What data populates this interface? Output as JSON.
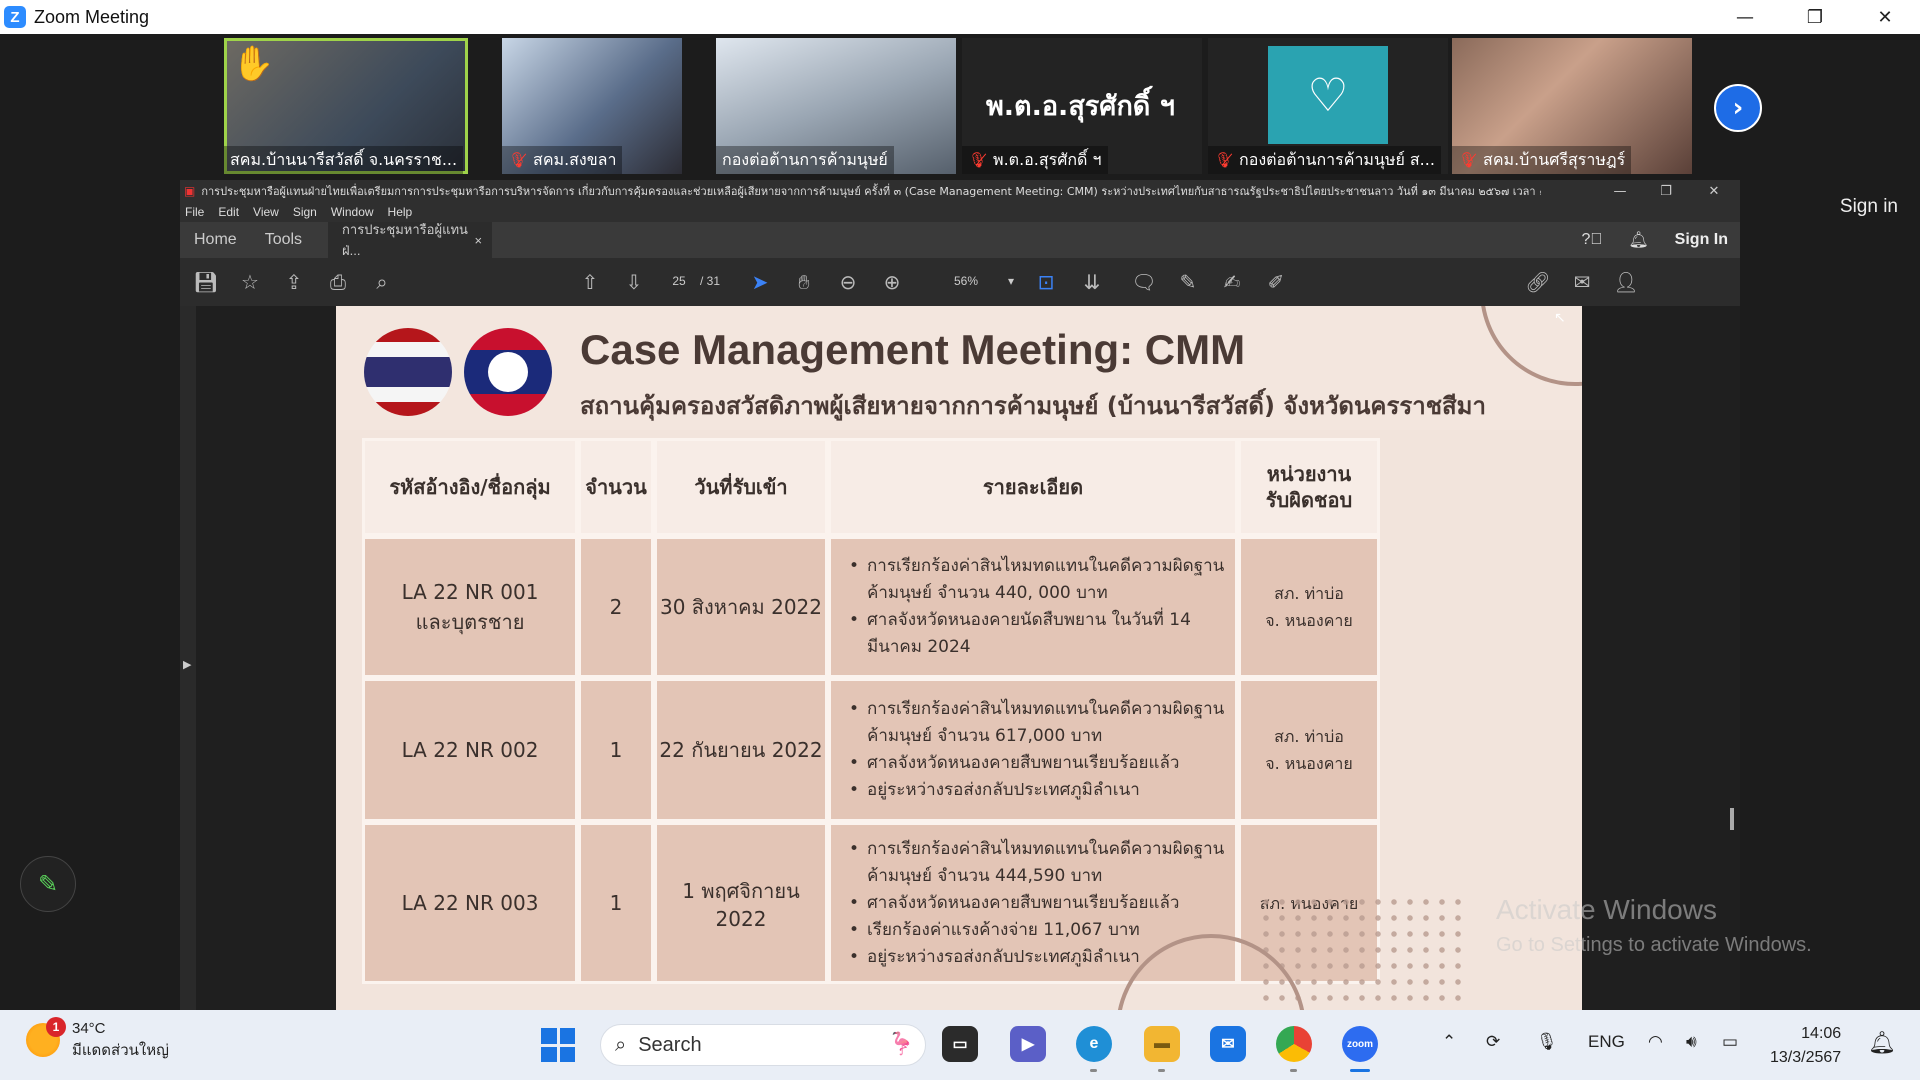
{
  "window": {
    "title": "Zoom Meeting",
    "minimize": "—",
    "maximize": "❐",
    "close": "✕"
  },
  "participants": [
    {
      "name": "สคม.บ้านนารีสวัสดิ์ จ.นครราช...",
      "muted": false,
      "raised_hand": true,
      "active": true
    },
    {
      "name": "สคม.สงขลา",
      "muted": true
    },
    {
      "name": "กองต่อต้านการค้ามนุษย์",
      "muted": false
    },
    {
      "name": "พ.ต.อ.สุรศักดิ์ ฯ",
      "muted": true,
      "display_text": "พ.ต.อ.สุรศักดิ์ ฯ"
    },
    {
      "name": "กองต่อต้านการค้ามนุษย์ ส...",
      "muted": true
    },
    {
      "name": "สคม.บ้านศรีสุราษฎร์",
      "muted": true
    }
  ],
  "zoom_side": {
    "sign_in": "Sign in"
  },
  "acrobat": {
    "doc_window_title": "การประชุมหารือผู้แทนฝ่ายไทยเพื่อเตรียมการการประชุมหารือการบริหารจัดการ เกี่ยวกับการคุ้มครองและช่วยเหลือผู้เสียหายจากการค้ามนุษย์ ครั้งที่ ๓ (Case Management Meeting: CMM) ระหว่างประเทศไทยกับสาธารณรัฐประชาธิปไตยประชาชนลาว วันที่ ๑๓ มีนาคม ๒๕๖๗ เวลา ๑๓.๓๐ -",
    "menu": [
      "File",
      "Edit",
      "View",
      "Sign",
      "Window",
      "Help"
    ],
    "tabs": {
      "home": "Home",
      "tools": "Tools",
      "doc": "การประชุมหารือผู้แทนฝ่...",
      "close": "×"
    },
    "sign_in": "Sign In",
    "page_current": "25",
    "page_total": "/ 31",
    "zoom": "56%"
  },
  "slide": {
    "title": "Case Management Meeting: CMM",
    "subtitle": "สถานคุ้มครองสวัสดิภาพผู้เสียหายจากการค้ามนุษย์ (บ้านนารีสวัสดิ์) จังหวัดนครราชสีมา",
    "headers": [
      "รหัสอ้างอิง/ชื่อกลุ่ม",
      "จำนวน",
      "วันที่รับเข้า",
      "รายละเอียด",
      "หน่วยงาน\nรับผิดชอบ"
    ],
    "rows": [
      {
        "ref": "LA 22 NR 001\nและบุตรชาย",
        "count": "2",
        "date": "30 สิงหาคม 2022",
        "details": [
          "การเรียกร้องค่าสินไหมทดแทนในคดีความผิดฐานค้ามนุษย์ จำนวน 440, 000 บาท",
          "ศาลจังหวัดหนองคายนัดสืบพยาน ในวันที่ 14 มีนาคม 2024"
        ],
        "unit": "สภ. ท่าบ่อ\nจ. หนองคาย"
      },
      {
        "ref": "LA 22 NR 002",
        "count": "1",
        "date": "22 กันยายน 2022",
        "details": [
          "การเรียกร้องค่าสินไหมทดแทนในคดีความผิดฐานค้ามนุษย์ จำนวน 617,000 บาท",
          "ศาลจังหวัดหนองคายสืบพยานเรียบร้อยแล้ว",
          "อยู่ระหว่างรอส่งกลับประเทศภูมิลำเนา"
        ],
        "unit": "สภ. ท่าบ่อ\nจ. หนองคาย"
      },
      {
        "ref": "LA 22 NR 003",
        "count": "1",
        "date": "1 พฤศจิกายน 2022",
        "details": [
          "การเรียกร้องค่าสินไหมทดแทนในคดีความผิดฐานค้ามนุษย์ จำนวน 444,590 บาท",
          "ศาลจังหวัดหนองคายสืบพยานเรียบร้อยแล้ว",
          "เรียกร้องค่าแรงค้างจ่าย 11,067 บาท",
          "อยู่ระหว่างรอส่งกลับประเทศภูมิลำเนา"
        ],
        "unit": "สภ. หนองคาย"
      }
    ]
  },
  "watermark": {
    "line1": "Activate Windows",
    "line2": "Go to Settings to activate Windows."
  },
  "taskbar": {
    "weather_temp": "34°C",
    "weather_desc": "มีแดดส่วนใหญ่",
    "weather_badge": "1",
    "search_placeholder": "Search",
    "zoom_label": "zoom",
    "language": "ENG",
    "time": "14:06",
    "date": "13/3/2567"
  }
}
